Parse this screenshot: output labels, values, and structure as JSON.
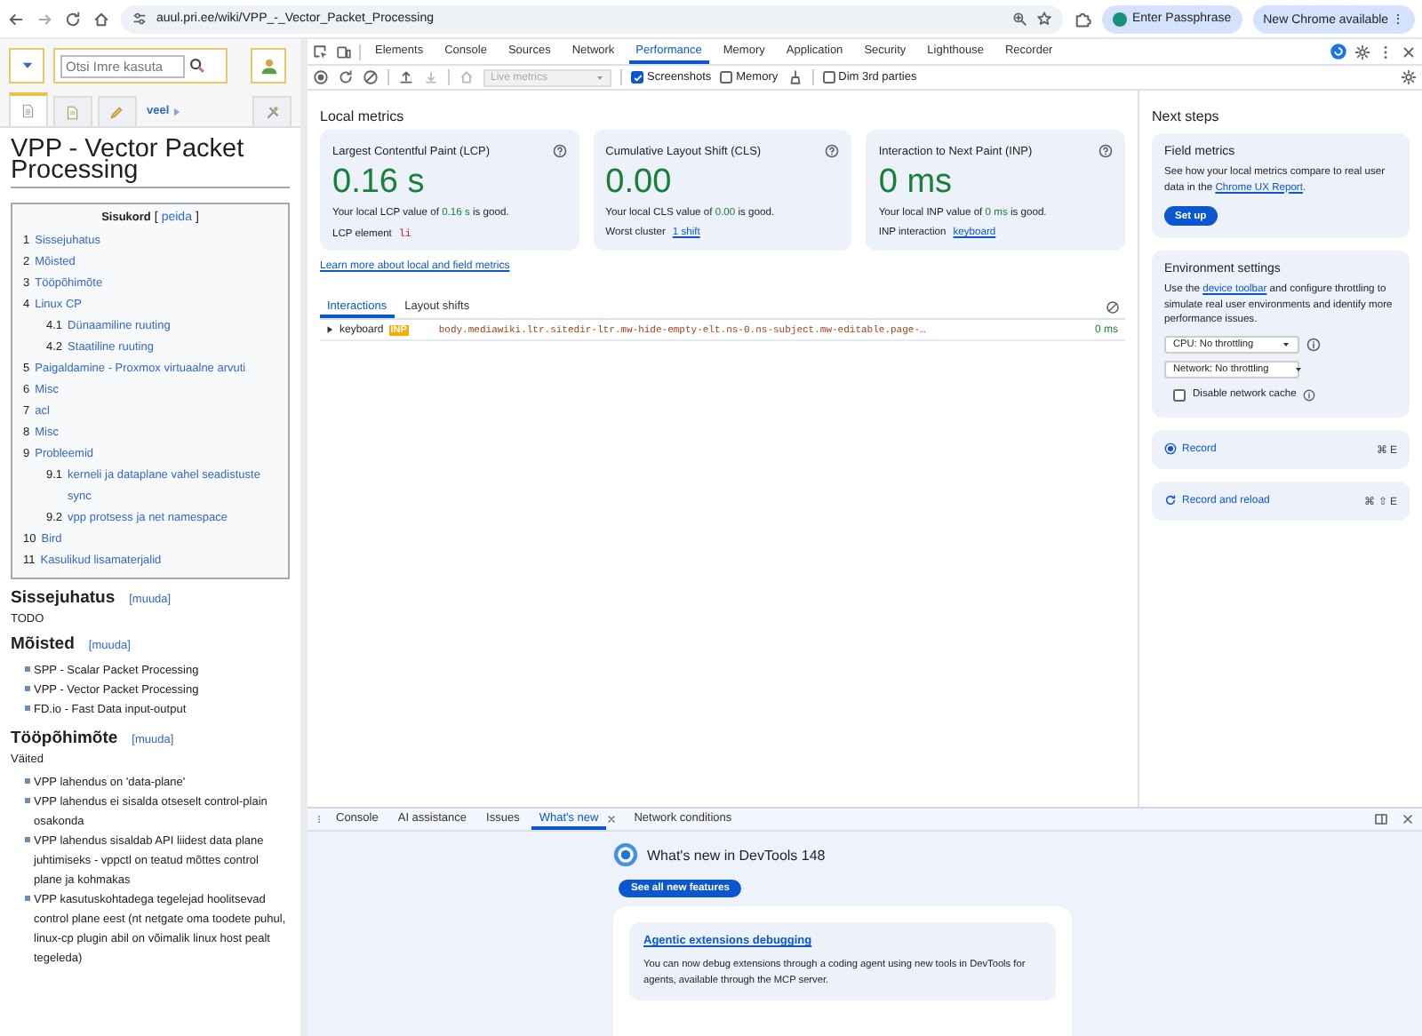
{
  "browser": {
    "url": "auul.pri.ee/wiki/VPP_-_Vector_Packet_Processing",
    "passphrase_button": "Enter Passphrase",
    "update_button": "New Chrome available",
    "update_menu": "⋮"
  },
  "wiki": {
    "search": {
      "placeholder": "Otsi Imre kasuta"
    },
    "tabs": [
      {
        "kind": "article",
        "selected": true
      },
      {
        "kind": "talk",
        "selected": false
      },
      {
        "kind": "edit",
        "selected": false
      },
      {
        "kind": "more",
        "label": "veel",
        "selected": false
      },
      {
        "kind": "tools",
        "selected": false
      }
    ],
    "title": "VPP - Vector Packet Processing",
    "toc": {
      "title": "Sisukord",
      "bracket_open": "[",
      "toggle": "peida",
      "bracket_close": "]",
      "items": [
        {
          "number": "1",
          "text": "Sissejuhatus"
        },
        {
          "number": "2",
          "text": "Mõisted"
        },
        {
          "number": "3",
          "text": "Tööpõhimõte"
        },
        {
          "number": "4",
          "text": "Linux CP",
          "children": [
            {
              "number": "4.1",
              "text": "Dünaamiline ruuting"
            },
            {
              "number": "4.2",
              "text": "Staatiline ruuting"
            }
          ]
        },
        {
          "number": "5",
          "text": "Paigaldamine - Proxmox virtuaalne arvuti"
        },
        {
          "number": "6",
          "text": "Misc"
        },
        {
          "number": "7",
          "text": "acl"
        },
        {
          "number": "8",
          "text": "Misc"
        },
        {
          "number": "9",
          "text": "Probleemid",
          "children": [
            {
              "number": "9.1",
              "text": "kerneli ja dataplane vahel seadistuste sync"
            },
            {
              "number": "9.2",
              "text": "vpp protsess ja net namespace"
            }
          ]
        },
        {
          "number": "10",
          "text": "Bird"
        },
        {
          "number": "11",
          "text": "Kasulikud lisamaterjalid"
        }
      ]
    },
    "sections": [
      {
        "heading": "Sissejuhatus",
        "edit": "[muuda]",
        "blocks": [
          {
            "kind": "paragraph",
            "text": "TODO"
          }
        ]
      },
      {
        "heading": "Mõisted",
        "edit": "[muuda]",
        "blocks": [
          {
            "kind": "list",
            "items": [
              "SPP - Scalar Packet Processing",
              "VPP - Vector Packet Processing",
              "FD.io - Fast Data input-output"
            ]
          }
        ]
      },
      {
        "heading": "Tööpõhimõte",
        "edit": "[muuda]",
        "blocks": [
          {
            "kind": "paragraph",
            "text": "Väited"
          },
          {
            "kind": "list",
            "items": [
              "VPP lahendus on 'data-plane'",
              "VPP lahendus ei sisalda otseselt control-plain osakonda",
              "VPP lahendus sisaldab API liidest data plane juhtimiseks - vppctl on teatud mõttes control plane ja kohmakas",
              "VPP kasutuskohtadega tegelejad hoolitsevad control plane eest (nt netgate oma toodete puhul, linux-cp plugin abil on võimalik linux host pealt tegeleda)"
            ]
          }
        ]
      }
    ]
  },
  "devtools": {
    "tabs": [
      {
        "label": "Elements",
        "selected": false
      },
      {
        "label": "Console",
        "selected": false
      },
      {
        "label": "Sources",
        "selected": false
      },
      {
        "label": "Network",
        "selected": false
      },
      {
        "label": "Performance",
        "selected": true
      },
      {
        "label": "Memory",
        "selected": false
      },
      {
        "label": "Application",
        "selected": false
      },
      {
        "label": "Security",
        "selected": false
      },
      {
        "label": "Lighthouse",
        "selected": false
      },
      {
        "label": "Recorder",
        "selected": false
      }
    ],
    "toolbar": {
      "mode_select": {
        "value": "Live metrics",
        "disabled": true
      },
      "checkboxes": [
        {
          "label": "Screenshots",
          "checked": true
        },
        {
          "label": "Memory",
          "checked": false
        },
        {
          "label": "Dim 3rd parties",
          "checked": false
        }
      ]
    },
    "local_metrics": {
      "title": "Local metrics",
      "cards": [
        {
          "title": "Largest Contentful Paint (LCP)",
          "value": "0.16 s",
          "note_before": "Your local LCP value of",
          "note_value": "0.16 s",
          "note_after": "is good.",
          "detail_label": "LCP element",
          "detail_code": "li"
        },
        {
          "title": "Cumulative Layout Shift (CLS)",
          "value": "0.00",
          "note_before": "Your local CLS value of",
          "note_value": "0.00",
          "note_after": "is good.",
          "detail_label": "Worst cluster",
          "detail_link": "1 shift"
        },
        {
          "title": "Interaction to Next Paint (INP)",
          "value": "0 ms",
          "note_before": "Your local INP value of",
          "note_value": "0 ms",
          "note_after": "is good.",
          "detail_label": "INP interaction",
          "detail_link": "keyboard"
        }
      ],
      "learn_more": "Learn more about local and field metrics",
      "subtabs": [
        {
          "label": "Interactions",
          "selected": true
        },
        {
          "label": "Layout shifts",
          "selected": false
        }
      ],
      "interactions": [
        {
          "type": "keyboard",
          "badge": "INP",
          "selector": "body.mediawiki.ltr.sitedir-ltr.mw-hide-empty-elt.ns-0.ns-subject.mw-editable.page-…",
          "duration": "0 ms"
        }
      ]
    },
    "next_steps": {
      "title": "Next steps",
      "field_metrics": {
        "title": "Field metrics",
        "text_before": "See how your local metrics compare to real user data in the",
        "link": "Chrome UX Report",
        "text_after": ".",
        "button": "Set up"
      },
      "environment": {
        "title": "Environment settings",
        "text_before": "Use the",
        "link": "device toolbar",
        "text_after": "and configure throttling to simulate real user environments and identify more performance issues.",
        "cpu": "CPU: No throttling",
        "network": "Network: No throttling",
        "cache": {
          "label": "Disable network cache",
          "checked": false
        }
      },
      "actions": [
        {
          "kind": "record",
          "label": "Record",
          "shortcut": "⌘ E"
        },
        {
          "kind": "reload",
          "label": "Record and reload",
          "shortcut": "⌘ ⇧ E"
        }
      ]
    },
    "drawer": {
      "tabs": [
        {
          "label": "Console",
          "selected": false
        },
        {
          "label": "AI assistance",
          "selected": false
        },
        {
          "label": "Issues",
          "selected": false
        },
        {
          "label": "What's new",
          "selected": true,
          "closable": true
        },
        {
          "label": "Network conditions",
          "selected": false
        }
      ],
      "whats_new": {
        "title": "What's new in DevTools 148",
        "button": "See all new features",
        "card": {
          "title": "Agentic extensions debugging",
          "text": "You can now debug extensions through a coding agent using new tools in DevTools for agents, available through the MCP server."
        }
      }
    }
  }
}
